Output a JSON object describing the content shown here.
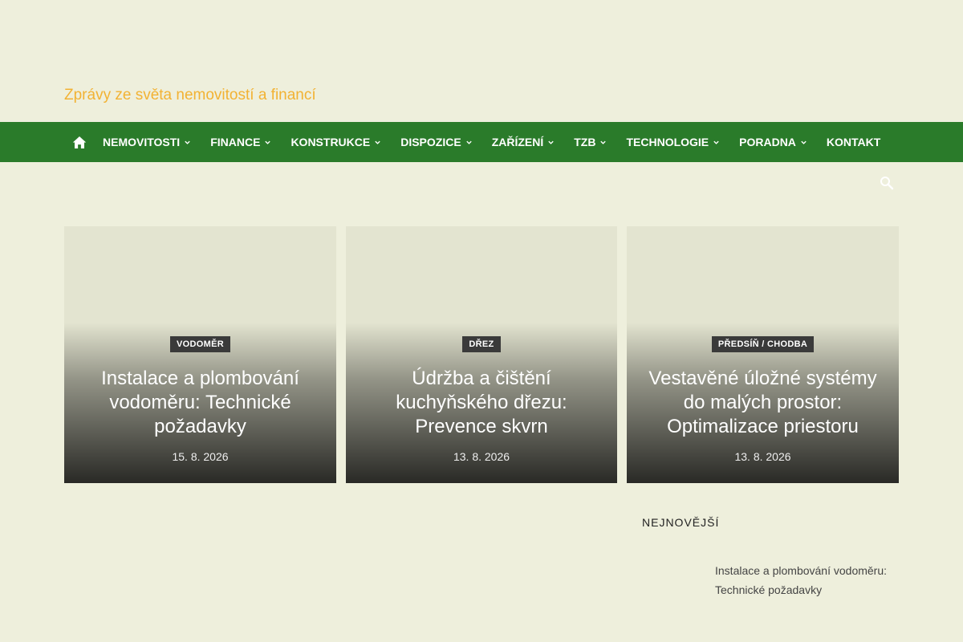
{
  "site": {
    "tagline": "Zprávy ze světa nemovitostí a financí"
  },
  "nav": {
    "items": [
      {
        "label": "NEMOVITOSTI",
        "dropdown": true
      },
      {
        "label": "FINANCE",
        "dropdown": true
      },
      {
        "label": "KONSTRUKCE",
        "dropdown": true
      },
      {
        "label": "DISPOZICE",
        "dropdown": true
      },
      {
        "label": "ZAŘÍZENÍ",
        "dropdown": true
      },
      {
        "label": "TZB",
        "dropdown": true
      },
      {
        "label": "TECHNOLOGIE",
        "dropdown": true
      },
      {
        "label": "PORADNA",
        "dropdown": true
      },
      {
        "label": "KONTAKT",
        "dropdown": false
      }
    ]
  },
  "featured": [
    {
      "category": "VODOMĚR",
      "title": "Instalace a plombování vodoměru: Technické požadavky",
      "date": "15. 8. 2026"
    },
    {
      "category": "DŘEZ",
      "title": "Údržba a čištění kuchyňského dřezu: Prevence skvrn",
      "date": "13. 8. 2026"
    },
    {
      "category": "PŘEDSÍŇ / CHODBA",
      "title": "Vestavěné úložné systémy do malých prostor: Optimalizace priestoru",
      "date": "13. 8. 2026"
    }
  ],
  "sidebar": {
    "newest_heading": "NEJNOVĚJŠÍ",
    "newest_items": [
      {
        "title": "Instalace a plombování vodoměru: Technické požadavky"
      }
    ]
  },
  "colors": {
    "background": "#eeefdc",
    "nav_bar": "#2a7b2a",
    "tagline": "#f2b233"
  },
  "icons": {
    "home": "home-icon",
    "search": "search-icon",
    "chevron": "chevron-down-icon"
  }
}
